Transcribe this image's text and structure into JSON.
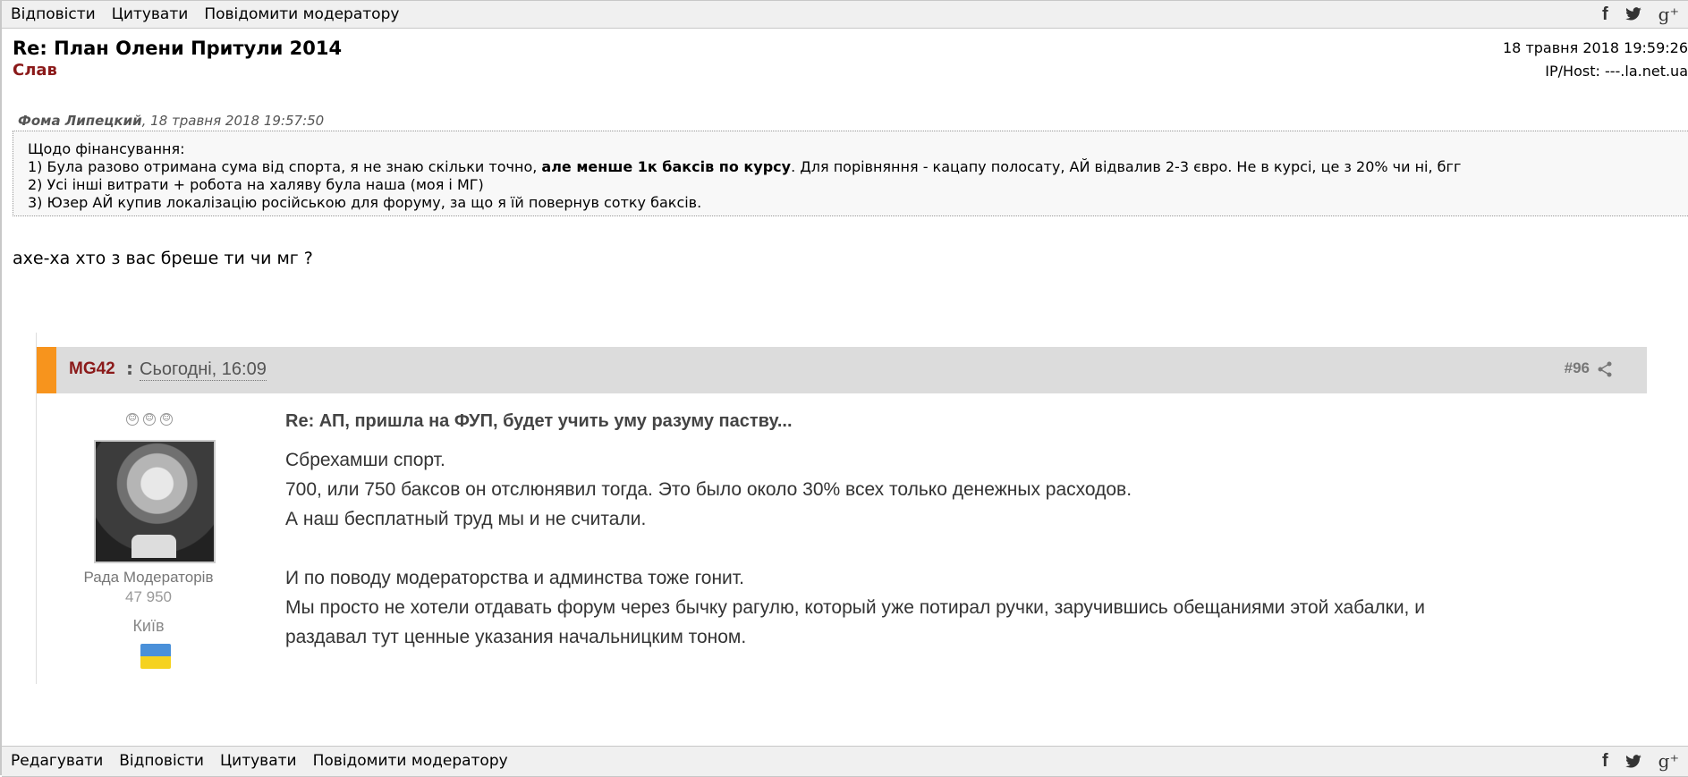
{
  "toolbar_top": {
    "reply": "Відповісти",
    "quote": "Цитувати",
    "report": "Повідомити модератору"
  },
  "social": {
    "facebook": "f",
    "gplus": "g⁺"
  },
  "post": {
    "title": "Re: План Олени Притули 2014",
    "author": "Слав",
    "date": "18 травня 2018 19:59:26",
    "ip": "IP/Host: ---.la.net.ua"
  },
  "quote": {
    "author": "Фома Липецкий",
    "date": ", 18 травня 2018 19:57:50",
    "line0": "Щодо фінансування:",
    "line1_pre": "1) Була разово отримана сума від спорта, я не знаю скільки точно, ",
    "line1_bold": "але менше 1к баксів по курсу",
    "line1_post": ". Для порівняння - кацапу полосату, АЙ відвалив 2-3 євро. Не в курсі, це з 20% чи ні, бгг",
    "line2": "2) Усі інші витрати + робота на халяву була наша (моя і МГ)",
    "line3": "3) Юзер АЙ купив локалізацію російською для форуму, за що я їй повернув сотку баксів."
  },
  "reply_text": "ахе-ха хто з вас бреше ти чи мг ?",
  "embedded": {
    "username": "MG42",
    "separator": ":",
    "time": "Сьогодні, 16:09",
    "post_number": "#96",
    "rank": "Рада Модераторів",
    "post_count": "47 950",
    "city": "Київ",
    "title": "Re: АП, пришла на ФУП, будет учить уму разуму паству...",
    "lines": [
      "Сбрехамши спорт.",
      "700, или 750 баксов он отслюнявил тогда. Это было около 30% всех только денежных расходов.",
      "А наш бесплатный труд мы и не считали.",
      "",
      "И по поводу модераторства и админства тоже гонит.",
      "Мы просто не хотели отдавать форум через бычку рагулю, который уже потирал ручки, заручившись обещаниями этой хабалки, и",
      "раздавал тут ценные указания начальницким тоном."
    ]
  },
  "toolbar_bottom": {
    "edit": "Редагувати",
    "reply": "Відповісти",
    "quote": "Цитувати",
    "report": "Повідомити модератору"
  }
}
